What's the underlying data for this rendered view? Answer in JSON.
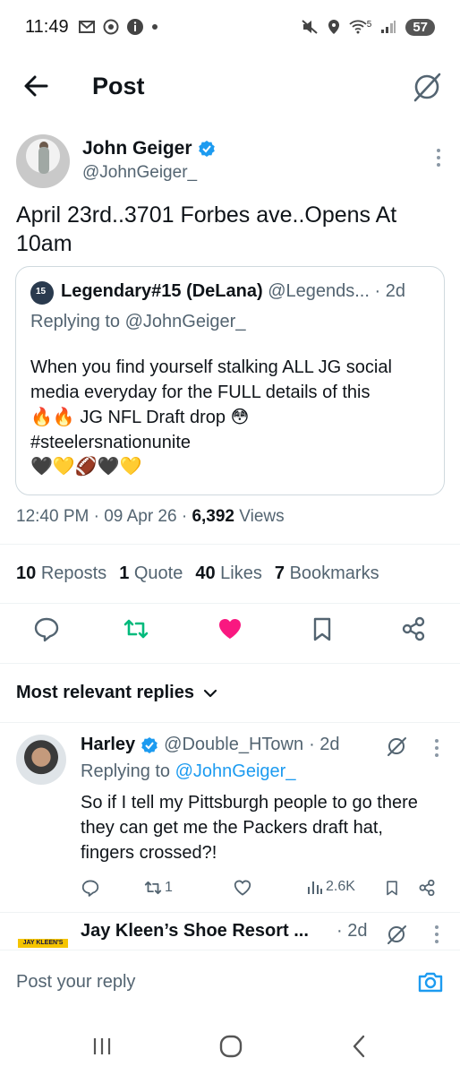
{
  "status_bar": {
    "time": "11:49",
    "left_icons": [
      "gmail-icon",
      "chrome-icon",
      "info-icon",
      "dot-icon"
    ],
    "right_icons": [
      "mute-icon",
      "location-icon",
      "wifi-icon",
      "signal-icon"
    ],
    "wifi_label": "5",
    "battery": "57"
  },
  "header": {
    "title": "Post"
  },
  "post": {
    "author_name": "John Geiger",
    "author_handle": "@JohnGeiger_",
    "text": "April 23rd..3701 Forbes ave..Opens At 10am",
    "quote": {
      "name": "Legendary#15 (DeLana)",
      "handle": "@Legends...",
      "time": "· 2d",
      "replying": "Replying to @JohnGeiger_",
      "text_line1": "When you find yourself stalking ALL JG social media everyday for the FULL details of this",
      "text_line2": "🔥🔥 JG NFL Draft drop 😳",
      "text_line3": "#steelersnationunite",
      "emojis": "🖤💛🏈🖤💛"
    },
    "time": "12:40 PM",
    "date": "09 Apr 26",
    "views_count": "6,392",
    "views_label": "Views",
    "reposts_count": "10",
    "reposts_label": "Reposts",
    "quotes_count": "1",
    "quotes_label": "Quote",
    "likes_count": "40",
    "likes_label": "Likes",
    "bookmarks_count": "7",
    "bookmarks_label": "Bookmarks"
  },
  "sort": {
    "label": "Most relevant replies"
  },
  "replies": [
    {
      "name": "Harley",
      "handle": "@Double_HTown",
      "time": "· 2d",
      "replying_prefix": "Replying to",
      "replying_to": "@JohnGeiger_",
      "text": "So if I tell my Pittsburgh people to go there they can get me the Packers draft hat, fingers crossed?!",
      "repost_count": "1",
      "views": "2.6K"
    },
    {
      "name": "Jay Kleen’s Shoe Resort ...",
      "time": "· 2d",
      "logo_text": "JAY KLEEN'S"
    }
  ],
  "composer": {
    "placeholder": "Post your reply"
  },
  "colors": {
    "accent": "#1d9bf0",
    "repost_green": "#00ba7c",
    "like_pink": "#f91880",
    "secondary_text": "#536471"
  }
}
